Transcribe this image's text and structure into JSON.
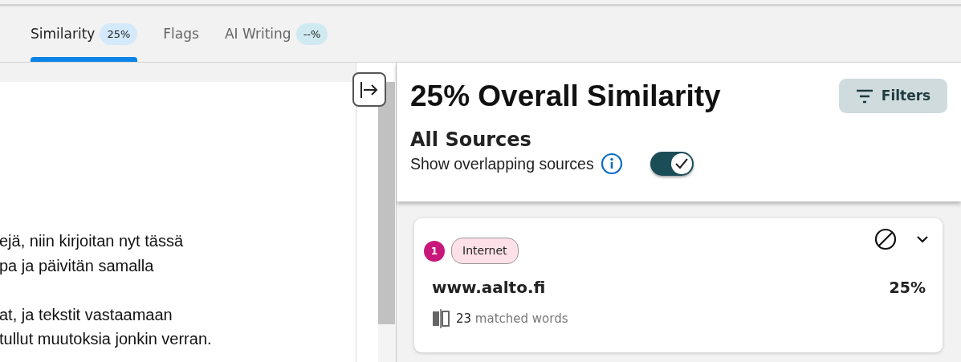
{
  "tabs": [
    {
      "label": "Similarity",
      "badge": "25%",
      "selected": true
    },
    {
      "label": "Flags",
      "selected": false
    },
    {
      "label": "AI Writing",
      "badge": "--%",
      "selected": false
    }
  ],
  "document": {
    "paragraphs": [
      {
        "lines": [
          "ejä, niin kirjoitan nyt tässä",
          "pa ja päivitän samalla"
        ]
      },
      {
        "lines": [
          "at, ja tekstit vastaamaan",
          "tullut muutoksia jonkin verran."
        ]
      }
    ]
  },
  "panel": {
    "title": "25% Overall Similarity",
    "filters_button": "Filters",
    "section_title": "All Sources",
    "toggle": {
      "label": "Show overlapping sources",
      "on": true
    },
    "sources": [
      {
        "number": "1",
        "color": "#c8177a",
        "type": "Internet",
        "name": "www.aalto.fi",
        "percent": "25%",
        "matched_count": "23",
        "matched_label": "matched words"
      }
    ]
  }
}
